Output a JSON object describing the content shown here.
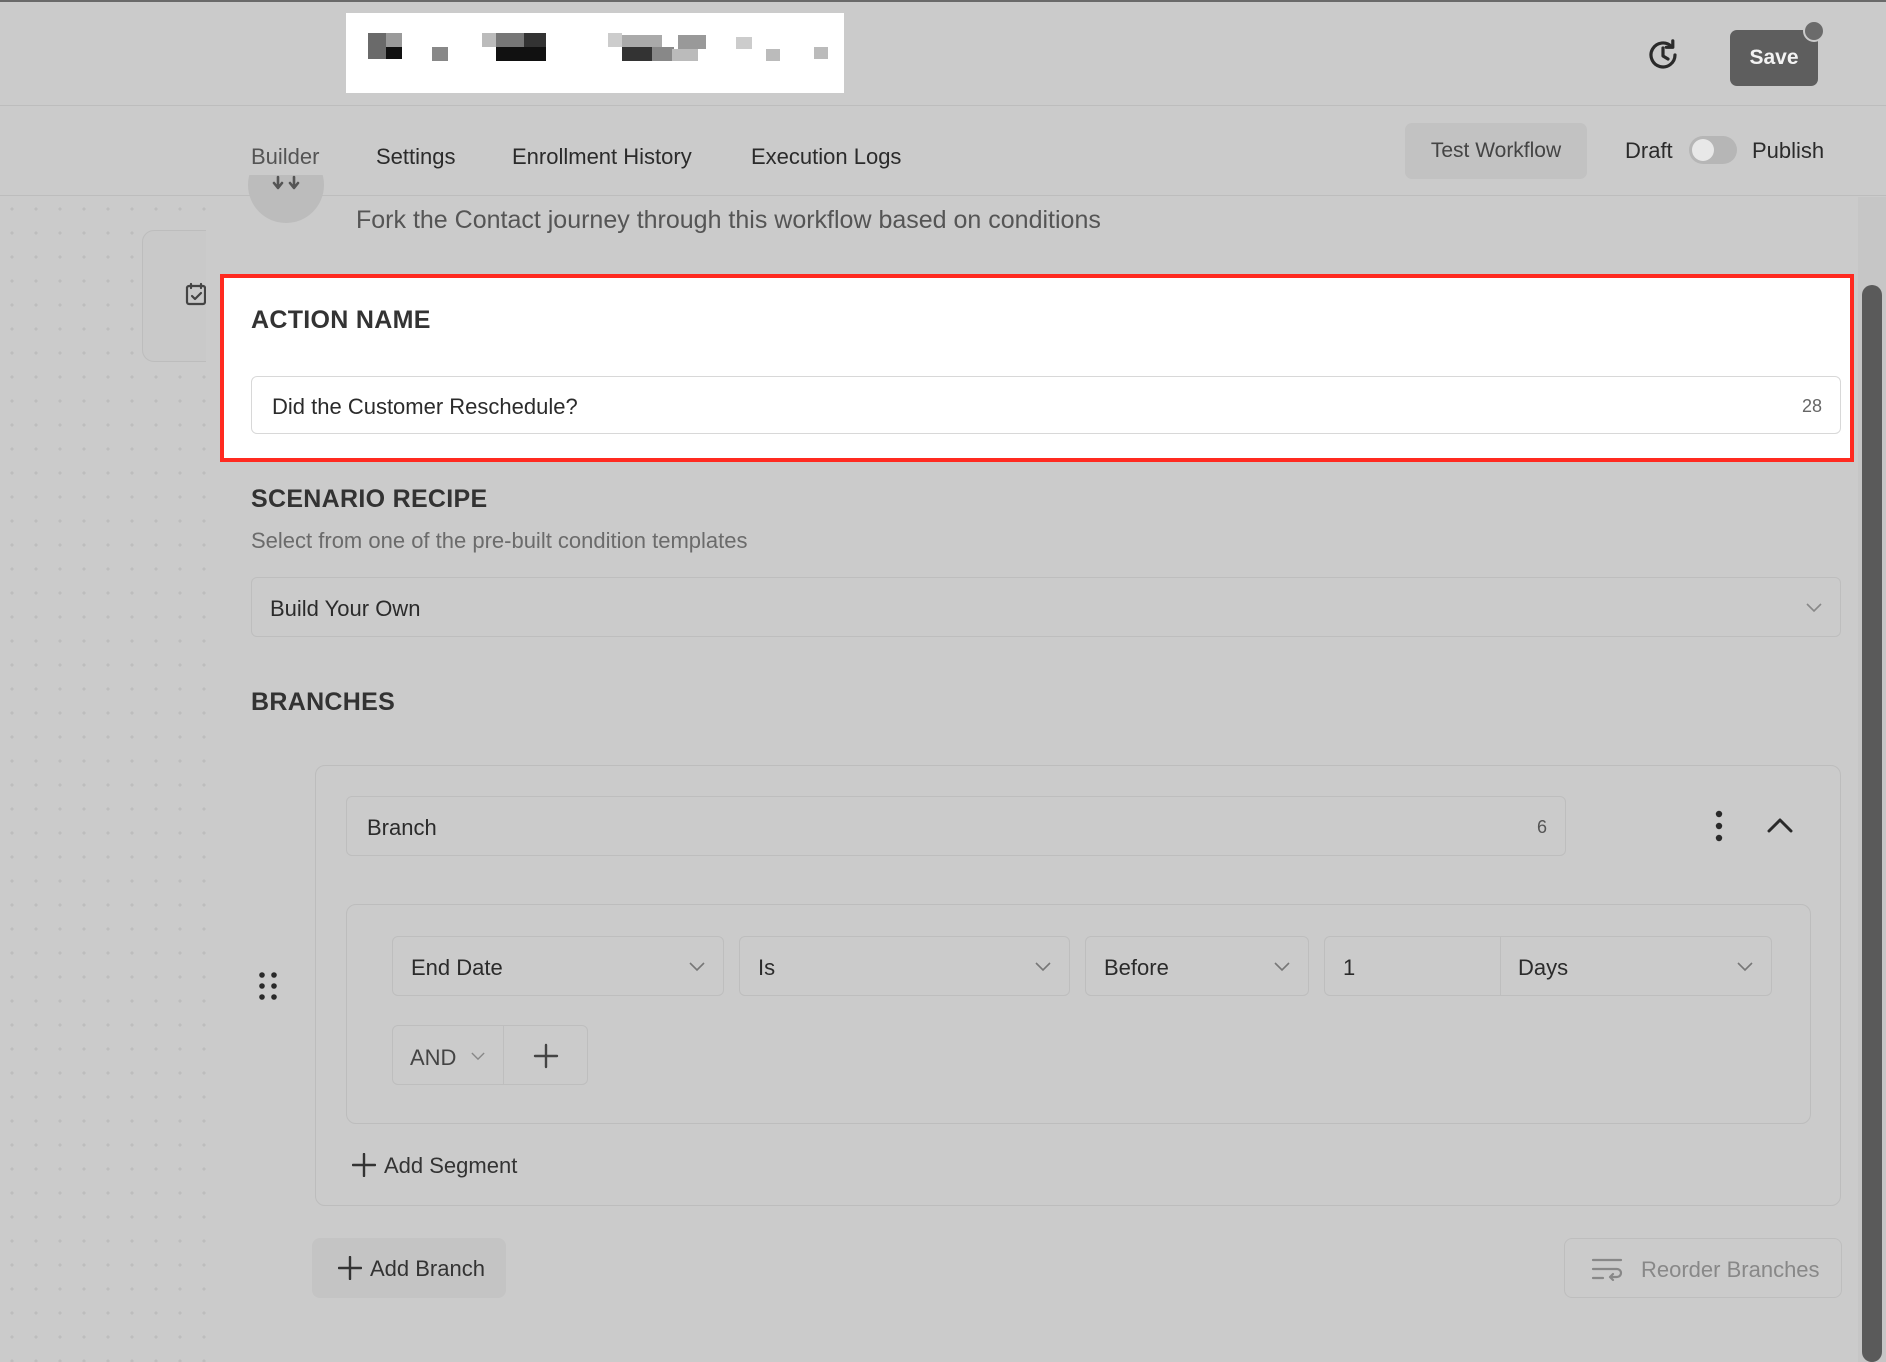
{
  "header": {
    "save_label": "Save",
    "history_icon": "history-icon"
  },
  "tabs": [
    {
      "label": "Builder",
      "active": true
    },
    {
      "label": "Settings",
      "active": false
    },
    {
      "label": "Enrollment History",
      "active": false
    },
    {
      "label": "Execution Logs",
      "active": false
    }
  ],
  "toolbar": {
    "test_workflow_label": "Test Workflow",
    "draft_label": "Draft",
    "publish_label": "Publish",
    "publish_enabled": false
  },
  "action": {
    "description": "Fork the Contact journey through this workflow based on conditions",
    "name_title": "ACTION NAME",
    "name_value": "Did the Customer Reschedule?",
    "name_count": "28"
  },
  "scenario": {
    "title": "SCENARIO RECIPE",
    "subtitle": "Select from one of the pre-built condition templates",
    "selected": "Build Your Own"
  },
  "branches": {
    "title": "BRANCHES",
    "items": [
      {
        "name": "Branch",
        "name_count": "6",
        "condition": {
          "field": "End Date",
          "operator": "Is",
          "relation": "Before",
          "amount": "1",
          "unit": "Days"
        },
        "joiner": "AND"
      }
    ],
    "add_segment_label": "Add Segment",
    "add_branch_label": "Add Branch",
    "reorder_label": "Reorder Branches"
  },
  "colors": {
    "highlight_border": "#ff2a20",
    "save_button": "#5e5e5e"
  }
}
